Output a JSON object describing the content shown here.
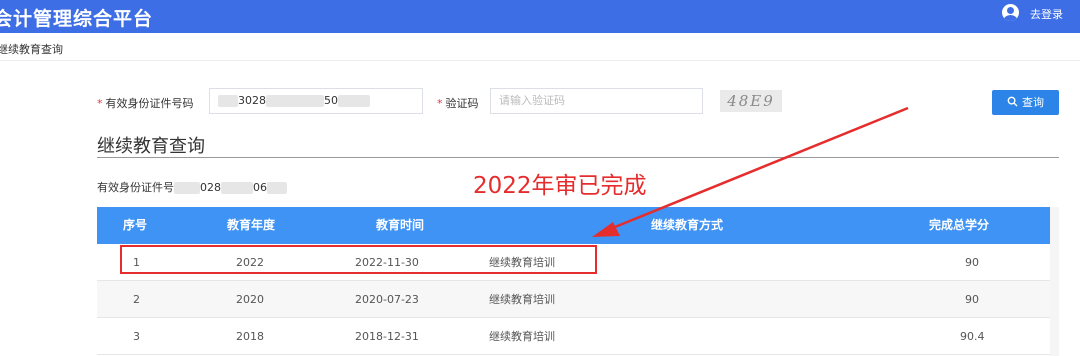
{
  "header": {
    "app_title": "会计管理综合平台",
    "login_label": "去登录",
    "color": "#3d6ee6"
  },
  "breadcrumb": "继续教育查询",
  "form": {
    "id_label": "有效身份证件号码",
    "id_value_a": "3028",
    "id_value_b": "50",
    "captcha_label": "验证码",
    "captcha_placeholder": "请输入验证码",
    "captcha_image_text": "48E9",
    "query_button": "查询"
  },
  "result": {
    "section_title": "继续教育查询",
    "id_display_label": "有效身份证件号",
    "id_display_a": "028",
    "id_display_b": "06"
  },
  "table": {
    "columns": [
      "序号",
      "教育年度",
      "教育时间",
      "继续教育方式",
      "完成总学分"
    ],
    "rows": [
      {
        "no": "1",
        "year": "2022",
        "date": "2022-11-30",
        "method": "继续教育培训",
        "credits": "90"
      },
      {
        "no": "2",
        "year": "2020",
        "date": "2020-07-23",
        "method": "继续教育培训",
        "credits": "90"
      },
      {
        "no": "3",
        "year": "2018",
        "date": "2018-12-31",
        "method": "继续教育培训",
        "credits": "90.4"
      }
    ]
  },
  "annotation": {
    "text": "2022年审已完成",
    "color": "#e62d2d"
  }
}
